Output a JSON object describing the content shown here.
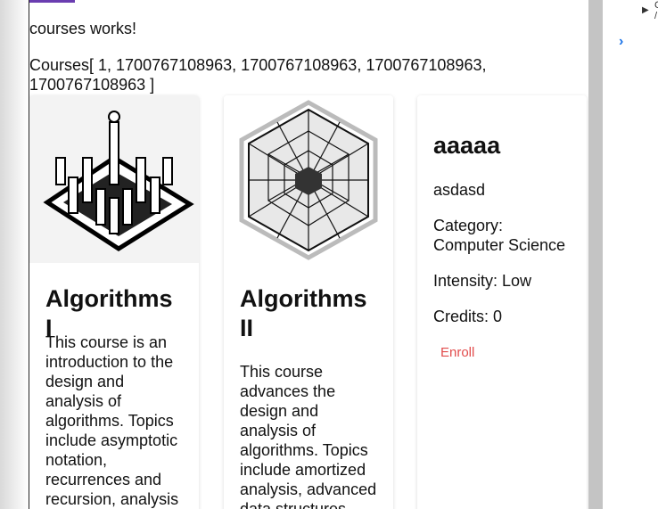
{
  "header": {
    "works_text": "courses works!",
    "courses_list_text": "Courses[ 1, 1700767108963, 1700767108963, 1700767108963, 1700767108963 ]"
  },
  "courses": [
    {
      "title": "Algorithms I",
      "description": "This course is an introduction to the design and analysis of algorithms. Topics include asymptotic notation, recurrences and recursion, analysis",
      "image_icon": "chess-pieces-icon"
    },
    {
      "title": "Algorithms II",
      "description": "This course advances the design and analysis of algorithms. Topics include amortized analysis, advanced data structures",
      "image_icon": "geometric-hexagon-icon"
    },
    {
      "title": "aaaaa",
      "description": "asdasd",
      "category": "Category: Computer Science",
      "intensity": "Intensity: Low",
      "credits": "Credits: 0",
      "enroll_label": "Enroll"
    }
  ],
  "devtools": {
    "expand_icon": "triangle-right-icon",
    "chevron_icon": "chevron-right-icon",
    "side_text": "C\n/"
  },
  "colors": {
    "enroll": "#e24c4c",
    "accent_tab": "#6a3db0",
    "chevron": "#1a73e8"
  }
}
